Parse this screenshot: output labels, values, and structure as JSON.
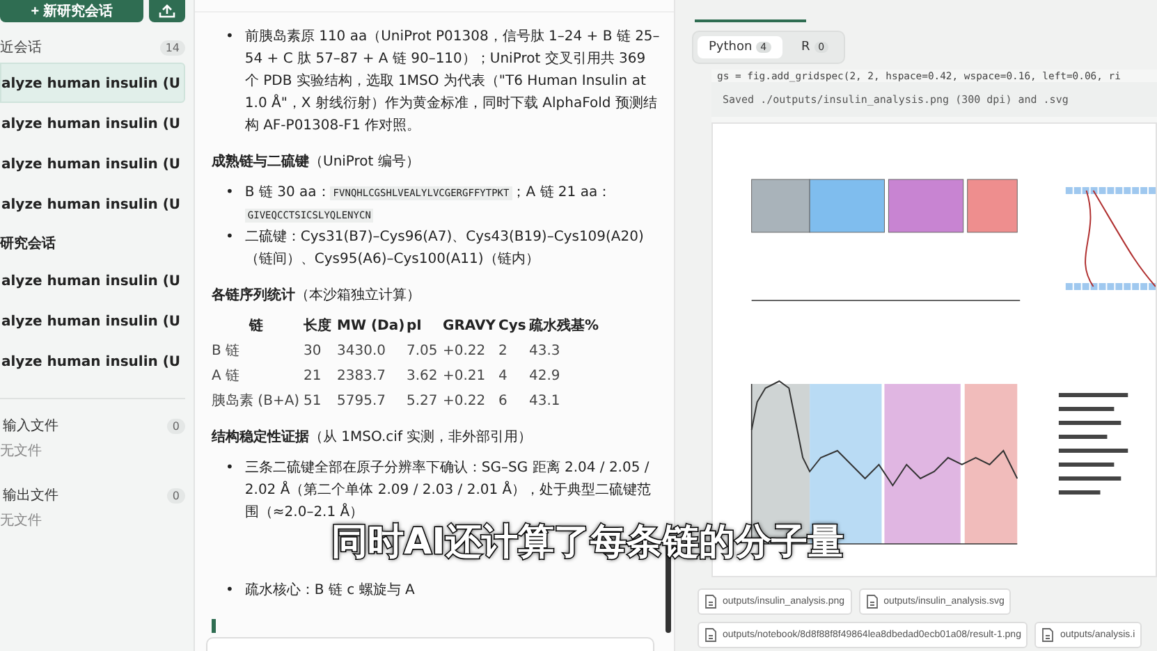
{
  "sidebar": {
    "new_session_button": {
      "icon": "+",
      "label": "新研究会话"
    },
    "sections": [
      {
        "title": "近会话",
        "count": "14",
        "items": [
          {
            "label": "alyze human insulin (U",
            "selected": true
          },
          {
            "label": "alyze human insulin (U",
            "selected": false
          },
          {
            "label": "alyze human insulin (U",
            "selected": false
          },
          {
            "label": "alyze human insulin (U",
            "selected": false
          }
        ]
      },
      {
        "title": "研究会话",
        "items": [
          {
            "label": "alyze human insulin (U",
            "selected": false
          },
          {
            "label": "alyze human insulin (U",
            "selected": false
          },
          {
            "label": "alyze human insulin (U",
            "selected": false
          }
        ]
      }
    ],
    "files": [
      {
        "title": "输入文件",
        "count": "0",
        "empty": "无文件"
      },
      {
        "title": "输出文件",
        "count": "0",
        "empty": "无文件"
      }
    ]
  },
  "chat": {
    "blocks": [
      {
        "kind": "bullets",
        "marker": "•",
        "items": [
          [
            {
              "kind": "text",
              "text": "前胰岛素原 110 aa（UniProt P01308，信号肽 1–24 + B 链 25–54 + C 肽 57–87 + A 链 90–110）；UniProt 交叉引用共 369 个 PDB 实验结构，选取 1MSO 为代表（\"T6 Human Insulin at 1.0 Å\"，X 射线衍射）作为黄金标准，同时下载 AlphaFold 预测结构 AF-P01308-F1 作对照。"
            }
          ]
        ]
      },
      {
        "kind": "heading",
        "text": "**成熟链与二硫键**（UniProt 编号）"
      },
      {
        "kind": "bullets",
        "marker": "•",
        "items": [
          [
            {
              "kind": "text",
              "text": "B 链 30 aa："
            },
            {
              "kind": "code",
              "text": "FVNQHLCGSHLVEALYLVCGERGFFYTPKT"
            },
            {
              "kind": "text",
              "text": "；A 链 21 aa："
            },
            {
              "kind": "code",
              "text": "GIVEQCCTSICSLYQLENYCN"
            }
          ],
          [
            {
              "kind": "text",
              "text": "二硫键：Cys31(B7)–Cys96(A7)、Cys43(B19)–Cys109(A20)（链间）、Cys95(A6)–Cys100(A11)（链内）"
            }
          ]
        ]
      },
      {
        "kind": "heading",
        "text": "**各链序列统计**（本沙箱独立计算）"
      },
      {
        "kind": "table",
        "columns": [
          "链",
          "长度",
          "MW (Da)",
          "pI",
          "GRAVY",
          "Cys",
          "疏水残基%"
        ],
        "rows": [
          [
            "B 链",
            "30",
            "3430.0",
            "7.05",
            "+0.22",
            "2",
            "43.3"
          ],
          [
            "A 链",
            "21",
            "2383.7",
            "3.62",
            "+0.21",
            "4",
            "42.9"
          ],
          [
            "胰岛素 (B+A)",
            "51",
            "5795.7",
            "5.27",
            "+0.22",
            "6",
            "43.1"
          ]
        ]
      },
      {
        "kind": "heading",
        "text": "**结构稳定性证据**（从 1MSO.cif 实测，非外部引用）"
      },
      {
        "kind": "bullets",
        "marker": "•",
        "items": [
          [
            {
              "kind": "text",
              "text": "三条二硫键全部在原子分辨率下确认：SG–SG 距离 2.04 / 2.05 / 2.02 Å（第二个单体 2.09 / 2.03 / 2.01 Å），处于典型二硫键范围（≈2.0–2.1 Å）"
            }
          ],
          [
            {
              "kind": "text",
              "text": "疏水核心：B 链 c 螺旋与 A"
            }
          ]
        ]
      },
      {
        "kind": "cursor"
      }
    ]
  },
  "caption": "同时AI还计算了每条链的分子量",
  "notebook": {
    "view_tabs": [
      {
        "label": "Python",
        "count": "4",
        "selected": true
      },
      {
        "label": "R",
        "count": "0",
        "selected": false
      }
    ],
    "code_line": "gs = fig.add_gridspec(2, 2, hspace=0.42, wspace=0.16, left=0.06, ri",
    "output_line": "Saved ./outputs/insulin_analysis.png (300 dpi) and .svg",
    "figure": {
      "kind": "picture"
    },
    "files": [
      [
        "outputs/insulin_analysis.png",
        "outputs/insulin_analysis.svg"
      ],
      [
        "outputs/notebook/8d8f88f8f49864lea8dbedad0ecb01a08/result-1.png",
        "outputs/analysis.i"
      ]
    ]
  }
}
